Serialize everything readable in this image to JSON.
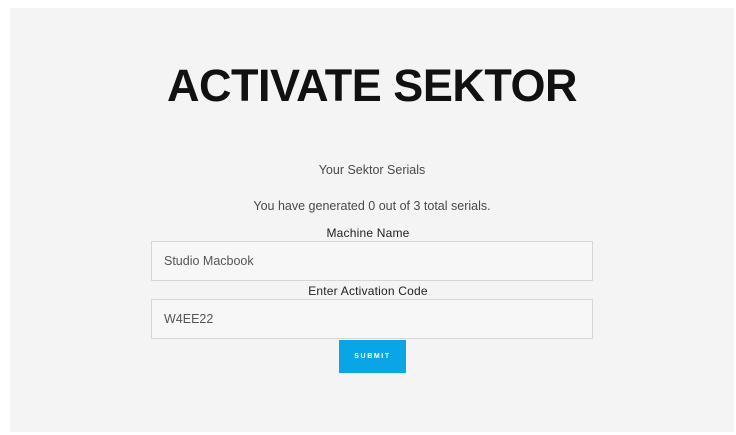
{
  "page": {
    "title": "ACTIVATE SEKTOR",
    "subtitle": "Your Sektor Serials",
    "serial_status": "You have generated 0 out of 3 total serials."
  },
  "form": {
    "machine_name": {
      "label": "Machine Name",
      "value": "Studio Macbook"
    },
    "activation_code": {
      "label": "Enter Activation Code",
      "value": "W4EE22"
    },
    "submit_label": "SUBMIT"
  },
  "colors": {
    "background": "#f4f4f4",
    "accent": "#0aa5e6",
    "title": "#111111"
  }
}
